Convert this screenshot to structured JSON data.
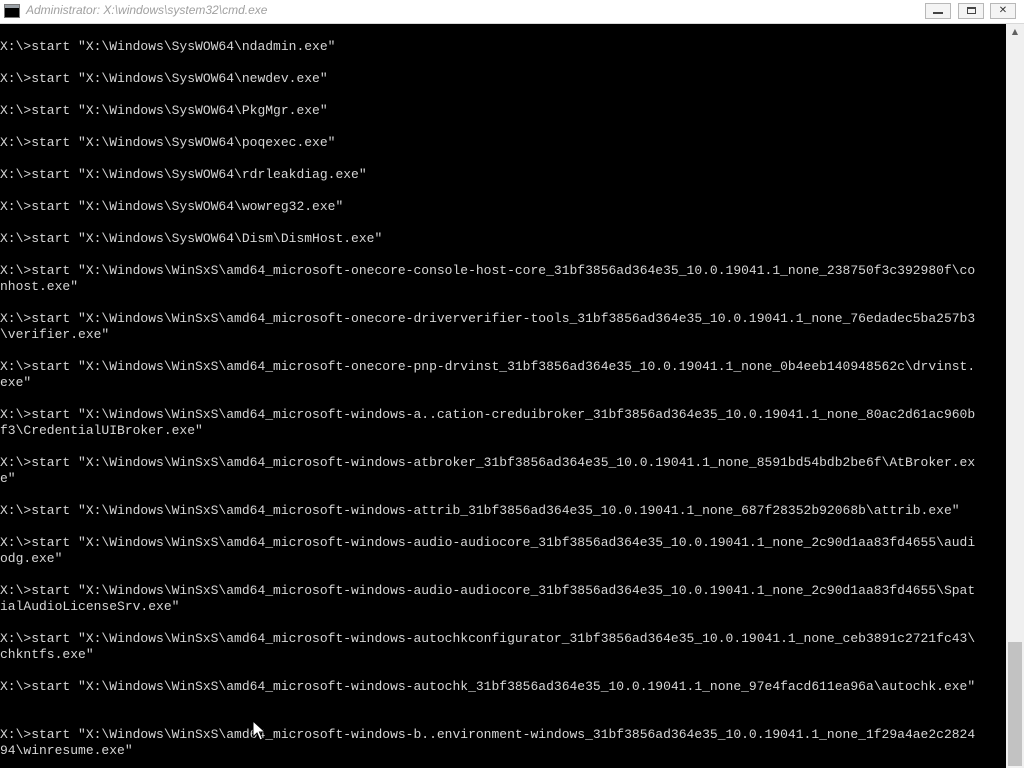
{
  "window": {
    "title": "Administrator: X:\\windows\\system32\\cmd.exe",
    "controls": {
      "minimize": "",
      "maximize": "",
      "close": "✕"
    }
  },
  "console": {
    "lines": [
      "X:\\>start \"X:\\Windows\\SysWOW64\\ndadmin.exe\"",
      "",
      "X:\\>start \"X:\\Windows\\SysWOW64\\newdev.exe\"",
      "",
      "X:\\>start \"X:\\Windows\\SysWOW64\\PkgMgr.exe\"",
      "",
      "X:\\>start \"X:\\Windows\\SysWOW64\\poqexec.exe\"",
      "",
      "X:\\>start \"X:\\Windows\\SysWOW64\\rdrleakdiag.exe\"",
      "",
      "X:\\>start \"X:\\Windows\\SysWOW64\\wowreg32.exe\"",
      "",
      "X:\\>start \"X:\\Windows\\SysWOW64\\Dism\\DismHost.exe\"",
      "",
      "X:\\>start \"X:\\Windows\\WinSxS\\amd64_microsoft-onecore-console-host-core_31bf3856ad364e35_10.0.19041.1_none_238750f3c392980f\\co",
      "nhost.exe\"",
      "",
      "X:\\>start \"X:\\Windows\\WinSxS\\amd64_microsoft-onecore-driververifier-tools_31bf3856ad364e35_10.0.19041.1_none_76edadec5ba257b3",
      "\\verifier.exe\"",
      "",
      "X:\\>start \"X:\\Windows\\WinSxS\\amd64_microsoft-onecore-pnp-drvinst_31bf3856ad364e35_10.0.19041.1_none_0b4eeb140948562c\\drvinst.",
      "exe\"",
      "",
      "X:\\>start \"X:\\Windows\\WinSxS\\amd64_microsoft-windows-a..cation-creduibroker_31bf3856ad364e35_10.0.19041.1_none_80ac2d61ac960b",
      "f3\\CredentialUIBroker.exe\"",
      "",
      "X:\\>start \"X:\\Windows\\WinSxS\\amd64_microsoft-windows-atbroker_31bf3856ad364e35_10.0.19041.1_none_8591bd54bdb2be6f\\AtBroker.ex",
      "e\"",
      "",
      "X:\\>start \"X:\\Windows\\WinSxS\\amd64_microsoft-windows-attrib_31bf3856ad364e35_10.0.19041.1_none_687f28352b92068b\\attrib.exe\"",
      "",
      "X:\\>start \"X:\\Windows\\WinSxS\\amd64_microsoft-windows-audio-audiocore_31bf3856ad364e35_10.0.19041.1_none_2c90d1aa83fd4655\\audi",
      "odg.exe\"",
      "",
      "X:\\>start \"X:\\Windows\\WinSxS\\amd64_microsoft-windows-audio-audiocore_31bf3856ad364e35_10.0.19041.1_none_2c90d1aa83fd4655\\Spat",
      "ialAudioLicenseSrv.exe\"",
      "",
      "X:\\>start \"X:\\Windows\\WinSxS\\amd64_microsoft-windows-autochkconfigurator_31bf3856ad364e35_10.0.19041.1_none_ceb3891c2721fc43\\",
      "chkntfs.exe\"",
      "",
      "X:\\>start \"X:\\Windows\\WinSxS\\amd64_microsoft-windows-autochk_31bf3856ad364e35_10.0.19041.1_none_97e4facd611ea96a\\autochk.exe\"",
      "",
      "",
      "X:\\>start \"X:\\Windows\\WinSxS\\amd64_microsoft-windows-b..environment-windows_31bf3856ad364e35_10.0.19041.1_none_1f29a4ae2c2824",
      "94\\winresume.exe\""
    ]
  },
  "scrollbar": {
    "position": 0.83
  },
  "colors": {
    "console_bg": "#000000",
    "console_text": "#d6d6d6",
    "title_text": "#a0a0a0"
  }
}
